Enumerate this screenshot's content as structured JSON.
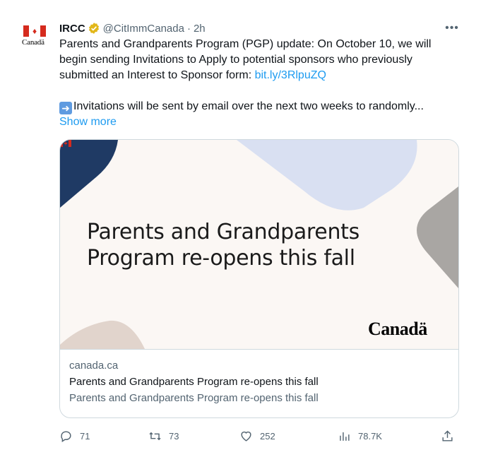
{
  "author": {
    "name": "IRCC",
    "handle": "@CitImmCanada",
    "separator": "·",
    "time": "2h",
    "avatar_wordmark": "Canadä"
  },
  "tweet": {
    "paragraph1": "Parents and Grandparents Program (PGP) update: On October 10, we will begin sending Invitations to Apply to potential sponsors who previously submitted an Interest to Sponsor form: ",
    "link": "bit.ly/3RlpuZQ",
    "paragraph2": "Invitations will be sent by email over the next two weeks to randomly...",
    "show_more": "Show more",
    "emoji_name": "right-arrow-emoji"
  },
  "card": {
    "image_headline_line1": "Parents and Grandparents",
    "image_headline_line2": "Program re-opens this fall",
    "image_wordmark": "Canadä",
    "domain": "canada.ca",
    "title": "Parents and Grandparents Program re-opens this fall",
    "description": "Parents and Grandparents Program re-opens this fall"
  },
  "actions": {
    "replies": "71",
    "retweets": "73",
    "likes": "252",
    "views": "78.7K"
  },
  "colors": {
    "link": "#1d9bf0",
    "secondary_text": "#536471",
    "verified_gold": "#e2b719",
    "canada_red": "#d52b1e",
    "shape_navy": "#1f3a64",
    "shape_lavender": "#d9e0f2",
    "shape_gray": "#a9a6a3",
    "shape_beige": "#e1d4cc"
  }
}
